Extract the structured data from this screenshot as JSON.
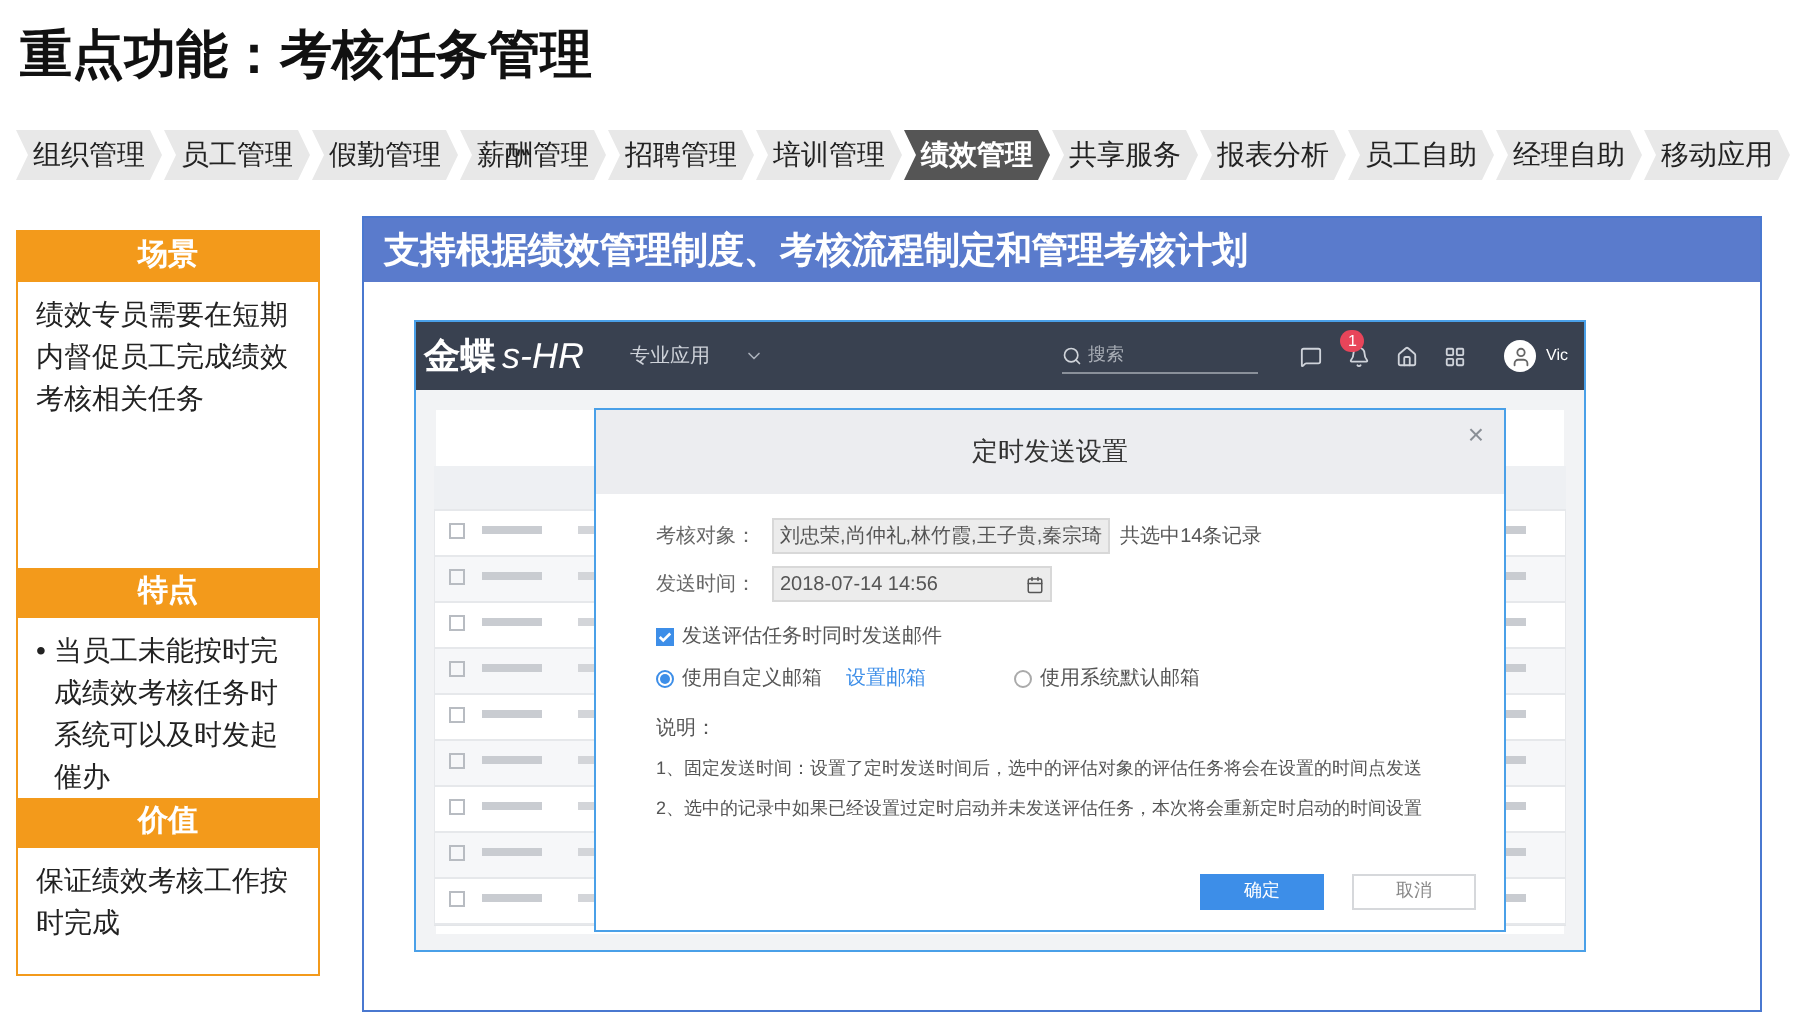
{
  "title": "重点功能：考核任务管理",
  "nav": [
    {
      "label": "组织管理",
      "selected": false
    },
    {
      "label": "员工管理",
      "selected": false
    },
    {
      "label": "假勤管理",
      "selected": false
    },
    {
      "label": "薪酬管理",
      "selected": false
    },
    {
      "label": "招聘管理",
      "selected": false
    },
    {
      "label": "培训管理",
      "selected": false
    },
    {
      "label": "绩效管理",
      "selected": true
    },
    {
      "label": "共享服务",
      "selected": false
    },
    {
      "label": "报表分析",
      "selected": false
    },
    {
      "label": "员工自助",
      "selected": false
    },
    {
      "label": "经理自助",
      "selected": false
    },
    {
      "label": "移动应用",
      "selected": false
    }
  ],
  "sections": [
    {
      "heading": "场景",
      "kind": "paragraph",
      "text": "绩效专员需要在短期内督促员工完成绩效考核相关任务"
    },
    {
      "heading": "特点",
      "kind": "bullets",
      "marker": "•",
      "items": [
        "当员工未能按时完成绩效考核任务时系统可以及时发起催办"
      ]
    },
    {
      "heading": "价值",
      "kind": "paragraph",
      "text": "保证绩效考核工作按时完成"
    }
  ],
  "panel": {
    "title": "支持根据绩效管理制度、考核流程制定和管理考核计划",
    "app": {
      "brand": "金蝶",
      "brand_suffix": "s-HR",
      "menu": "专业应用",
      "search_placeholder": "搜索",
      "badge": "1",
      "user": "Vic"
    },
    "dialog": {
      "title": "定时发送设置",
      "close": "×",
      "fields": [
        {
          "label": "考核对象：",
          "value": "刘忠荣,尚仲礼,林竹霞,王子贵,秦宗琦",
          "note": "共选中14条记录",
          "kind": "text"
        },
        {
          "label": "发送时间：",
          "value": "2018-07-14 14:56",
          "kind": "date"
        }
      ],
      "checkbox": {
        "label": "发送评估任务时同时发送邮件",
        "checked": true
      },
      "radios": [
        {
          "label": "使用自定义邮箱",
          "selected": true,
          "link": "设置邮箱"
        },
        {
          "label": "使用系统默认邮箱",
          "selected": false
        }
      ],
      "notes_title": "说明：",
      "notes": [
        "1、固定发送时间：设置了定时发送时间后，选中的评估对象的评估任务将会在设置的时间点发送",
        "2、选中的记录中如果已经设置过定时启动并未发送评估任务，本次将会重新定时启动的时间设置"
      ],
      "buttons": [
        {
          "label": "确定",
          "kind": "primary"
        },
        {
          "label": "取消",
          "kind": "secondary"
        }
      ]
    }
  }
}
